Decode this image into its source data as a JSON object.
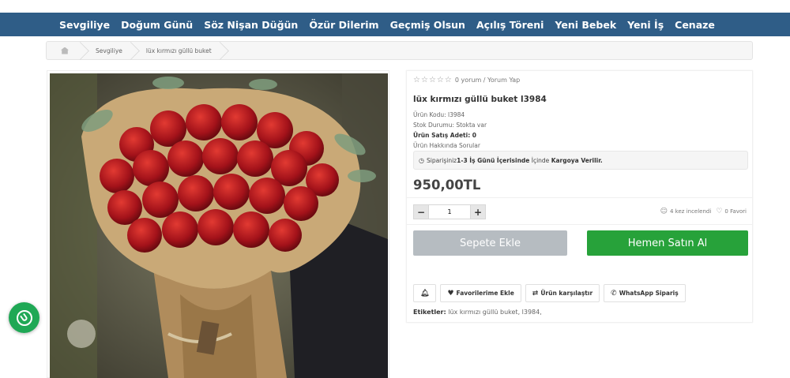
{
  "nav": {
    "items": [
      "Sevgiliye",
      "Doğum Günü",
      "Söz Nişan Düğün",
      "Özür Dilerim",
      "Geçmiş Olsun",
      "Açılış Töreni",
      "Yeni Bebek",
      "Yeni İş",
      "Cenaze"
    ]
  },
  "breadcrumb": {
    "home_icon": "home-icon",
    "items": [
      "Sevgiliye",
      "lüx kırmızı güllü buket"
    ]
  },
  "product": {
    "image_alt": "lüx kırmızı güllü buket",
    "rating": {
      "stars": 0,
      "max": 5,
      "text": "0 yorum / Yorum Yap"
    },
    "title": "lüx kırmızı güllü buket l3984",
    "code": "Ürün Kodu: l3984",
    "stock": "Stok Durumu: Stokta var",
    "sales": "Ürün Satış Adeti: 0",
    "questions": "Ürün Hakkında Sorular",
    "cargo": {
      "pre": "Siparişiniz ",
      "days": "1-3 İş Günü İçerisinde",
      "mid": " İçinde ",
      "end": "Kargoya Verilir."
    },
    "price": "950,00TL",
    "quantity": "1",
    "views": "4 kez incelendi",
    "favorites": "0 Favori",
    "add_to_cart": "Sepete Ekle",
    "buy_now": "Hemen Satın Al",
    "actions": {
      "favorite": "Favorilerime Ekle",
      "compare": "Ürün karşılaştır",
      "whatsapp": "WhatsApp Sipariş"
    },
    "tags": {
      "label": "Etiketler:",
      "value": "lüx kırmızı güllü buket, l3984,"
    }
  },
  "colors": {
    "nav": "#2f5d87",
    "buy": "#27a23a",
    "cart": "#b6bcc1",
    "whatsapp": "#1fa855"
  }
}
